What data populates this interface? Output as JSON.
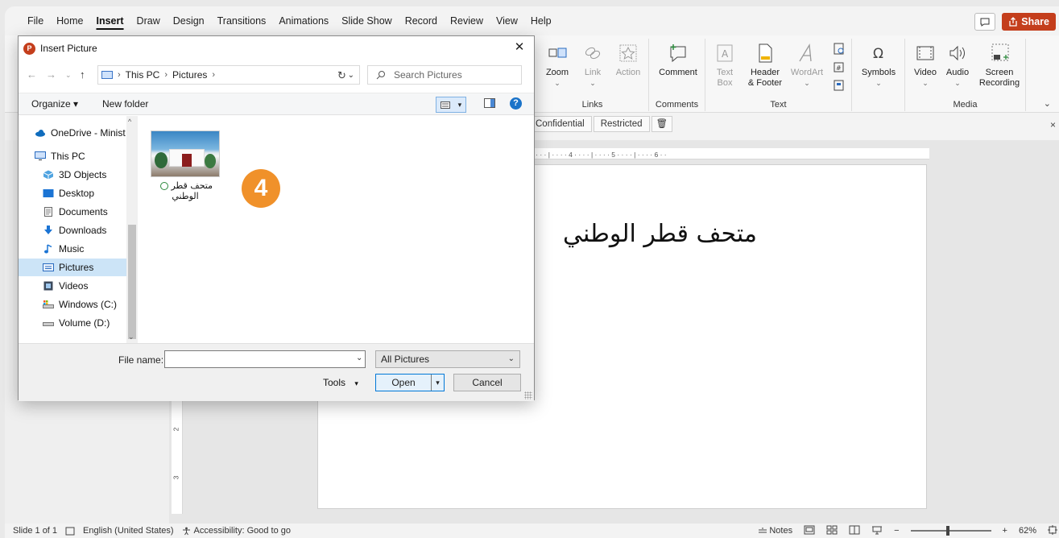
{
  "menubar": {
    "tabs": [
      "File",
      "Home",
      "Insert",
      "Draw",
      "Design",
      "Transitions",
      "Animations",
      "Slide Show",
      "Record",
      "Review",
      "View",
      "Help"
    ],
    "active_tab": "Insert",
    "share_label": "Share"
  },
  "ribbon": {
    "links_group": {
      "label": "Links",
      "zoom": "Zoom",
      "link": "Link",
      "action": "Action"
    },
    "comments_group": {
      "label": "Comments",
      "comment": "Comment"
    },
    "text_group": {
      "label": "Text",
      "text_box_1": "Text",
      "text_box_2": "Box",
      "header_1": "Header",
      "header_2": "& Footer",
      "wordart": "WordArt"
    },
    "symbols_group": {
      "symbols": "Symbols"
    },
    "media_group": {
      "label": "Media",
      "video": "Video",
      "audio": "Audio",
      "screen_1": "Screen",
      "screen_2": "Recording"
    }
  },
  "sensitivity": {
    "confidential": "Confidential",
    "restricted": "Restricted"
  },
  "slide": {
    "text": "متحف قطر الوطني"
  },
  "statusbar": {
    "slide_info": "Slide 1 of 1",
    "language": "English (United States)",
    "accessibility": "Accessibility: Good to go",
    "notes": "Notes",
    "zoom": "62%"
  },
  "dialog": {
    "title": "Insert Picture",
    "path": [
      "This PC",
      "Pictures"
    ],
    "search_placeholder": "Search Pictures",
    "organize": "Organize ▾",
    "new_folder": "New folder",
    "nav_items": [
      {
        "label": "OneDrive - Minist",
        "icon": "cloud-icon"
      },
      {
        "label": "This PC",
        "icon": "computer-icon"
      },
      {
        "label": "3D Objects",
        "icon": "cube-icon"
      },
      {
        "label": "Desktop",
        "icon": "desktop-icon"
      },
      {
        "label": "Documents",
        "icon": "document-icon"
      },
      {
        "label": "Downloads",
        "icon": "download-arrow-icon"
      },
      {
        "label": "Music",
        "icon": "music-note-icon"
      },
      {
        "label": "Pictures",
        "icon": "pictures-folder-icon"
      },
      {
        "label": "Videos",
        "icon": "film-icon"
      },
      {
        "label": "Windows (C:)",
        "icon": "drive-c-icon"
      },
      {
        "label": "Volume (D:)",
        "icon": "drive-icon"
      }
    ],
    "selected_nav": "Pictures",
    "file": {
      "name_line1": "متحف قطر",
      "name_line2": "الوطني"
    },
    "step_badge": "4",
    "file_name_label": "File name:",
    "file_name_value": "",
    "file_type": "All Pictures",
    "tools": "Tools",
    "open": "Open",
    "cancel": "Cancel"
  }
}
